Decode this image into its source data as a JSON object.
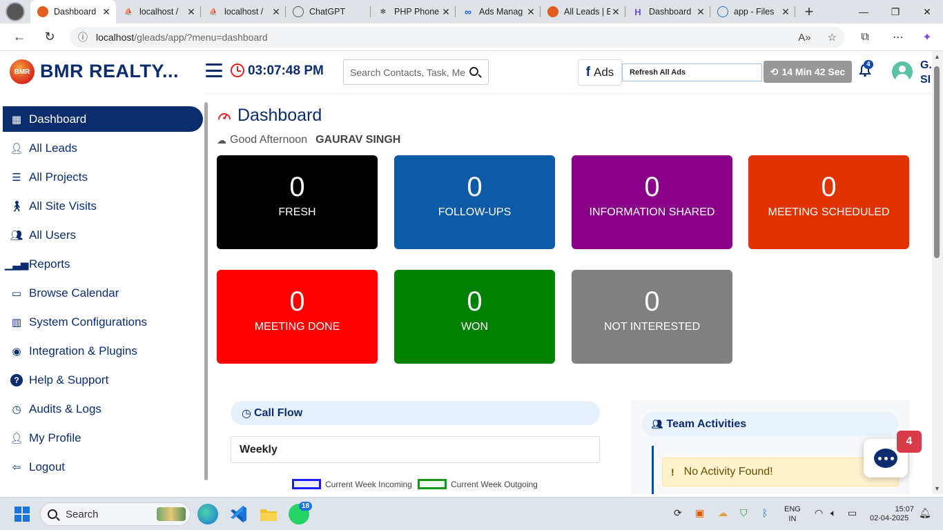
{
  "browser": {
    "tabs": [
      {
        "label": "Dashboard",
        "active": true,
        "icon": "orange-logo-icon"
      },
      {
        "label": "localhost /",
        "active": false,
        "icon": "phpmyadmin-icon"
      },
      {
        "label": "localhost /",
        "active": false,
        "icon": "phpmyadmin-icon"
      },
      {
        "label": "ChatGPT",
        "active": false,
        "icon": "chatgpt-icon"
      },
      {
        "label": "PHP Phone",
        "active": false,
        "icon": "chatgpt-icon"
      },
      {
        "label": "Ads Manag",
        "active": false,
        "icon": "meta-icon"
      },
      {
        "label": "All Leads | E",
        "active": false,
        "icon": "orange-logo-icon"
      },
      {
        "label": "Dashboard",
        "active": false,
        "icon": "h-logo-icon"
      },
      {
        "label": "app - Files",
        "active": false,
        "icon": "globe-icon"
      }
    ],
    "address": {
      "host": "localhost",
      "path": "/gleads/app/?menu=dashboard"
    }
  },
  "header": {
    "logo_text": "BMR",
    "brand": "BMR REALTY...",
    "time": "03:07:48 PM",
    "search_placeholder": "Search Contacts, Task, Me",
    "fb_label": "Ads",
    "refresh_label": "Refresh All Ads",
    "timer": "14 Min 42 Sec",
    "notif_count": "4",
    "user_short": "G. SI"
  },
  "sidebar": {
    "items": [
      {
        "label": "Dashboard",
        "icon": "grid-icon",
        "active": true
      },
      {
        "label": "All Leads",
        "icon": "user-icon"
      },
      {
        "label": "All Projects",
        "icon": "list-icon"
      },
      {
        "label": "All Site Visits",
        "icon": "walking-icon"
      },
      {
        "label": "All Users",
        "icon": "users-icon"
      },
      {
        "label": "Reports",
        "icon": "bar-chart-icon"
      },
      {
        "label": "Browse Calendar",
        "icon": "calendar-icon"
      },
      {
        "label": "System Configurations",
        "icon": "building-icon"
      },
      {
        "label": "Integration & Plugins",
        "icon": "plugin-icon"
      },
      {
        "label": "Help & Support",
        "icon": "help-icon"
      },
      {
        "label": "Audits & Logs",
        "icon": "history-icon"
      },
      {
        "label": "My Profile",
        "icon": "user-icon"
      },
      {
        "label": "Logout",
        "icon": "logout-icon"
      }
    ]
  },
  "main": {
    "title": "Dashboard",
    "greeting": "Good Afternoon",
    "user_name": "GAURAV SINGH",
    "cards": [
      {
        "value": "0",
        "label": "FRESH",
        "color": "#000000"
      },
      {
        "value": "0",
        "label": "FOLLOW-UPS",
        "color": "#0d5aa7"
      },
      {
        "value": "0",
        "label": "INFORMATION SHARED",
        "color": "#870087"
      },
      {
        "value": "0",
        "label": "MEETING SCHEDULED",
        "color": "#e03300"
      },
      {
        "value": "0",
        "label": "MEETING DONE",
        "color": "#ff0000"
      },
      {
        "value": "0",
        "label": "WON",
        "color": "#008000"
      },
      {
        "value": "0",
        "label": "NOT INTERESTED",
        "color": "#808080"
      }
    ],
    "callflow": {
      "title": "Call Flow",
      "period": "Weekly",
      "legend_incoming": "Current Week Incoming",
      "legend_outgoing": "Current Week Outgoing"
    },
    "team": {
      "title": "Team Activities",
      "empty": "No Activity Found!"
    },
    "chat_badge": "4"
  },
  "taskbar": {
    "search": "Search",
    "whatsapp_badge": "18",
    "lang1": "ENG",
    "lang2": "IN",
    "time": "15:07",
    "date": "02-04-2025"
  }
}
